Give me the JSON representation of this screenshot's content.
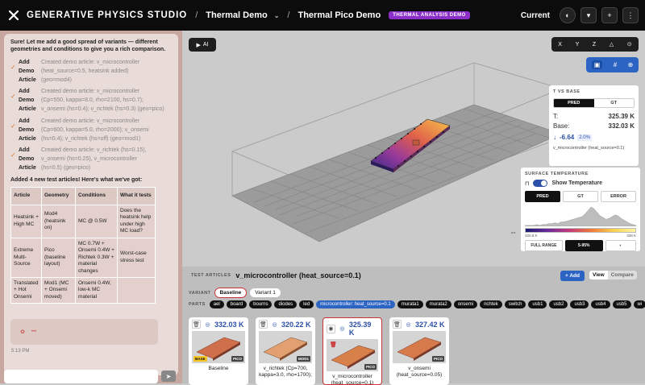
{
  "topbar": {
    "brand": "GENERATIVE PHYSICS STUDIO",
    "crumb1": "Thermal Demo",
    "crumb2": "Thermal Pico Demo",
    "badge": "THERMAL ANALYSIS DEMO",
    "current_label": "Current"
  },
  "chat": {
    "intro": "Sure! Let me add a good spread of variants — different geometries and conditions to give you a rich comparison.",
    "tasks": [
      {
        "l1": "Add",
        "l2": "Demo",
        "l3": "Article",
        "t1": "Created demo article: v_microcontroller",
        "t2": "(heat_source=0.5, heatsink added)",
        "t3": "(geo=mod4)"
      },
      {
        "l1": "Add",
        "l2": "Demo",
        "l3": "Article",
        "t1": "Created demo article: v_microcontroller",
        "t2": "(Cp=550, kappa=8.0, rho=2100, hs=0.7);",
        "t3": "v_onsemi (hs=0.4); v_richtek (hs=0.3) (geo=pico)"
      },
      {
        "l1": "Add",
        "l2": "Demo",
        "l3": "Article",
        "t1": "Created demo article: v_microcontroller",
        "t2": "(Cp=600, kappa=5.0, rho=2000); v_onsemi",
        "t3": "(hs=0.4); v_richtek (hs=off) (geo=mod1)"
      },
      {
        "l1": "Add",
        "l2": "Demo",
        "l3": "Article",
        "t1": "Created demo article: v_richtek (hs=0.15),",
        "t2": "v_onsemi (hs=0.25), v_microcontroller",
        "t3": "(hs=0.5) (geo=pico)"
      }
    ],
    "summary": "Added 4 new test articles! Here's what we've got:",
    "table": {
      "headers": [
        "Article",
        "Geometry",
        "Conditions",
        "What it tests"
      ],
      "rows": [
        [
          "Heatsink + High MC",
          "Mod4 (heatsink on)",
          "MC @ 0.5W",
          "Does the heatsink help under high MC load?"
        ],
        [
          "Extreme Multi-Source",
          "Pico (baseline layout)",
          "MC 0.7W + Onsemi 0.4W + Richtek 0.3W + material changes",
          "Worst-case stress test"
        ],
        [
          "Translated + Hot Onsemi",
          "Mod1 (MC + Onsemi moved)",
          "Onsemi 0.4W, low-k MC material",
          ""
        ]
      ]
    },
    "timestamp": "5:13 PM"
  },
  "viewer": {
    "ai_label": "AI",
    "axes": [
      "X",
      "Y",
      "Z",
      "△",
      "⊙"
    ]
  },
  "t_vs_base": {
    "title": "T VS BASE",
    "tabs": [
      "PRED",
      "GT"
    ],
    "t_label": "T:",
    "t_value": "325.39 K",
    "base_label": "Base:",
    "base_value": "332.03 K",
    "delta": "-6.64",
    "delta_pct": "2.0%",
    "footer": "v_microcontroller (heat_source=0.1)"
  },
  "surface_temp": {
    "title": "SURFACE TEMPERATURE",
    "show_label": "Show Temperature",
    "tabs": [
      "PRED",
      "GT",
      "ERROR"
    ],
    "min_label": "320.6 K",
    "max_label": "328 K",
    "range_full": "FULL RANGE",
    "range_pct": "5-95%",
    "hist": [
      1,
      1,
      1,
      1,
      2,
      1,
      2,
      2,
      3,
      3,
      4,
      3,
      5,
      5,
      6,
      7,
      8,
      9,
      10,
      11,
      14,
      18,
      22,
      20,
      16,
      12,
      10,
      8,
      9,
      11,
      13,
      12,
      9,
      7,
      5,
      3,
      2,
      1
    ]
  },
  "bottom": {
    "label": "TEST ARTICLES",
    "current": "v_microcontroller (heat_source=0.1)",
    "add_label": "+ Add",
    "view_label": "View",
    "compare_label": "Compare",
    "variant_label": "VARIANT",
    "variants": [
      "Baseline",
      "Variant 1"
    ],
    "parts_label": "PARTS",
    "parts": [
      "ael",
      "board",
      "bourns",
      "diodes",
      "led",
      "microcontroller: heat_source=0.1",
      "murata1",
      "murata2",
      "onsemi",
      "richtek",
      "switch",
      "usb1",
      "usb2",
      "usb3",
      "usb4",
      "usb5",
      "wi"
    ],
    "cards": [
      {
        "value": "332.03 K",
        "badge": "PICO",
        "badge2": "BASE",
        "name": "Baseline",
        "icon": "trash"
      },
      {
        "value": "320.22 K",
        "badge": "MOD1",
        "badge2": "",
        "name": "v_richtek (Cp=700, kappa=3.0, rho=1700);",
        "icon": "trash"
      },
      {
        "value": "325.39 K",
        "badge": "PICO",
        "badge2": "",
        "name": "v_microcontroller (heat_source=0.1)",
        "icon": "eye"
      },
      {
        "value": "327.42 K",
        "badge": "PICO",
        "badge2": "",
        "name": "v_onsemi (heat_source=0.05)",
        "icon": "trash"
      }
    ]
  },
  "colors": {
    "accent": "#2c64c4",
    "brand": "#8b2fc9",
    "selected": "#cc3333"
  }
}
